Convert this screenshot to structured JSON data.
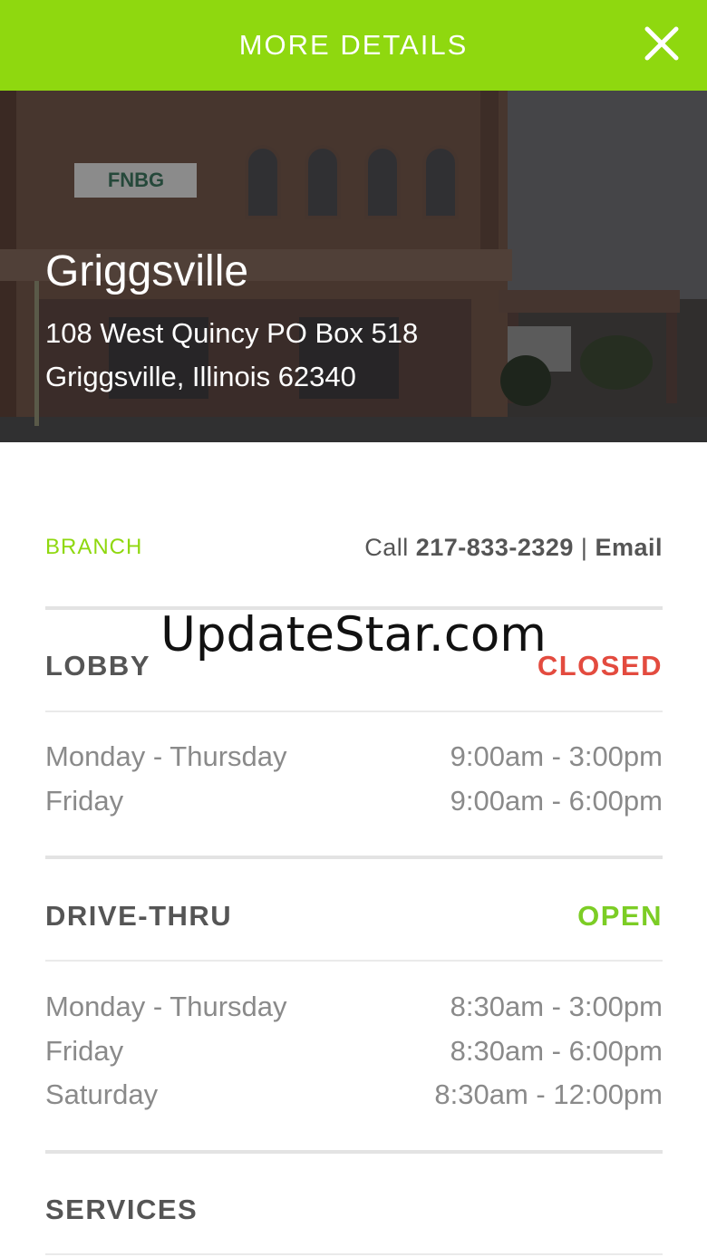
{
  "header": {
    "title": "MORE DETAILS",
    "close_icon": "close-icon"
  },
  "branch": {
    "name": "Griggsville",
    "address_line1": "108 West Quincy PO Box 518",
    "address_line2": "Griggsville, Illinois 62340",
    "sign_text": "FNBG"
  },
  "contact": {
    "label": "BRANCH",
    "call_prefix": "Call",
    "phone": "217-833-2329",
    "separator": "|",
    "email": "Email"
  },
  "lobby": {
    "title": "LOBBY",
    "status": "CLOSED",
    "hours": [
      {
        "day": "Monday - Thursday",
        "time": "9:00am - 3:00pm"
      },
      {
        "day": "Friday",
        "time": "9:00am - 6:00pm"
      }
    ]
  },
  "drive_thru": {
    "title": "DRIVE-THRU",
    "status": "OPEN",
    "hours": [
      {
        "day": "Monday - Thursday",
        "time": "8:30am - 3:00pm"
      },
      {
        "day": "Friday",
        "time": "8:30am - 6:00pm"
      },
      {
        "day": "Saturday",
        "time": "8:30am - 12:00pm"
      }
    ]
  },
  "services": {
    "title": "SERVICES"
  },
  "watermark": "UpdateStar.com",
  "colors": {
    "accent": "#8fd80f",
    "closed": "#e34b3f",
    "open": "#7ccd25"
  }
}
